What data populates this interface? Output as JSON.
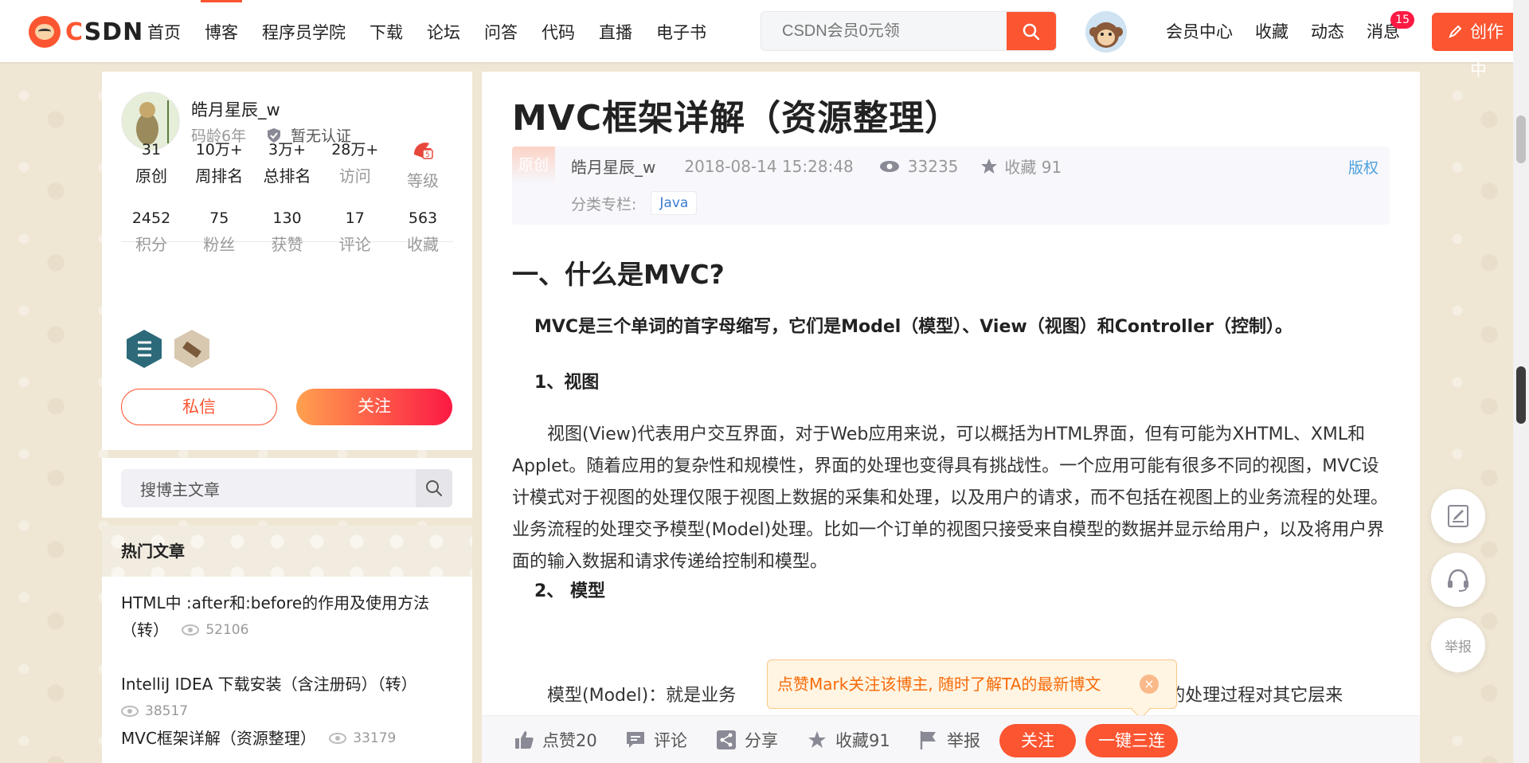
{
  "topbar": {
    "logo_text": "CSDN",
    "nav": [
      "首页",
      "博客",
      "程序员学院",
      "下载",
      "论坛",
      "问答",
      "代码",
      "直播",
      "电子书"
    ],
    "active_nav": 1,
    "search_placeholder": "CSDN会员0元领",
    "right_nav": [
      "会员中心",
      "收藏",
      "动态",
      "消息"
    ],
    "message_count": "15",
    "create_label": "创作中",
    "brand_color": "#fc5531"
  },
  "profile": {
    "name": "皓月星辰_w",
    "age": "码龄6年",
    "cert": "暂无认证",
    "stats_row1": [
      {
        "num": "31",
        "label": "原创"
      },
      {
        "num": "10万+",
        "label": "周排名"
      },
      {
        "num": "3万+",
        "label": "总排名"
      },
      {
        "num": "28万+",
        "label": "访问"
      },
      {
        "num": "",
        "label": "等级"
      }
    ],
    "stats_row2": [
      {
        "num": "2452",
        "label": "积分"
      },
      {
        "num": "75",
        "label": "粉丝"
      },
      {
        "num": "130",
        "label": "获赞"
      },
      {
        "num": "17",
        "label": "评论"
      },
      {
        "num": "563",
        "label": "收藏"
      }
    ],
    "msg_button": "私信",
    "follow_button": "关注"
  },
  "sidebar": {
    "search_placeholder": "搜博主文章",
    "hot_title": "热门文章",
    "hot_articles": [
      {
        "title": "HTML中 :after和:before的作用及使用方法（转）",
        "views": "52106"
      },
      {
        "title": "IntelliJ IDEA 下载安装（含注册码）（转）",
        "views": "38517"
      },
      {
        "title": "MVC框架详解（资源整理）",
        "views": "33179"
      }
    ]
  },
  "article": {
    "title": "MVC框架详解（资源整理）",
    "orig_tag": "原创",
    "author": "皓月星辰_w",
    "time": "2018-08-14 15:28:48",
    "views": "33235",
    "fav": "收藏 91",
    "copyright": "版权",
    "category_label": "分类专栏:",
    "category": "Java",
    "h1": "一、什么是MVC?",
    "lead": "MVC是三个单词的首字母缩写，它们是Model（模型）、View（视图）和Controller（控制）。",
    "h3_view": "1、视图",
    "para_view": "视图(View)代表用户交互界面，对于Web应用来说，可以概括为HTML界面，但有可能为XHTML、XML和Applet。随着应用的复杂性和规模性，界面的处理也变得具有挑战性。一个应用可能有很多不同的视图，MVC设计模式对于视图的处理仅限于视图上数据的采集和处理，以及用户的请求，而不包括在视图上的业务流程的处理。业务流程的处理交予模型(Model)处理。比如一个订单的视图只接受来自模型的数据并显示给用户，以及将用户界面的输入数据和请求传递给控制和模型。",
    "h3_model": "2、 模型",
    "para_model_start": "模型(Model)：就是业务",
    "para_model_end": "程的处理过程对其它层来"
  },
  "toolbar": {
    "like": "点赞20",
    "comment": "评论",
    "share": "分享",
    "fav": "收藏91",
    "report": "举报",
    "follow": "关注",
    "triple": "一键三连"
  },
  "tooltip": {
    "text": "点赞Mark关注该博主, 随时了解TA的最新博文",
    "close": "×"
  },
  "float": {
    "report": "举报"
  }
}
